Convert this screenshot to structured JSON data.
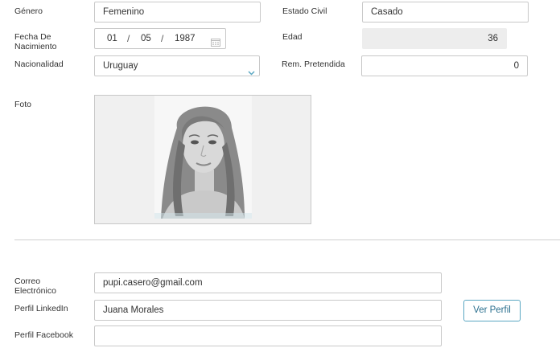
{
  "labels": {
    "genero": "Género",
    "estado_civil": "Estado Civil",
    "fecha_nac_1": "Fecha De",
    "fecha_nac_2": "Nacimiento",
    "edad": "Edad",
    "nacionalidad": "Nacionalidad",
    "rem_pretendida": "Rem. Pretendida",
    "foto": "Foto",
    "correo_1": "Correo",
    "correo_2": "Electrónico",
    "linkedin": "Perfil LinkedIn",
    "facebook": "Perfil Facebook"
  },
  "values": {
    "genero": "Femenino",
    "estado_civil": "Casado",
    "fecha_dia": "01",
    "fecha_mes": "05",
    "fecha_anio": "1987",
    "fecha_sep": "/",
    "edad": "36",
    "nacionalidad": "Uruguay",
    "rem_pretendida": "0",
    "correo": "pupi.casero@gmail.com",
    "linkedin": "Juana Morales",
    "facebook": ""
  },
  "buttons": {
    "ver_perfil": "Ver Perfil"
  },
  "icons": {
    "calendar": "calendar-icon",
    "dropdown": "chevron-down-icon"
  },
  "colors": {
    "accent": "#5aa7c2",
    "readonly_bg": "#ededed"
  }
}
